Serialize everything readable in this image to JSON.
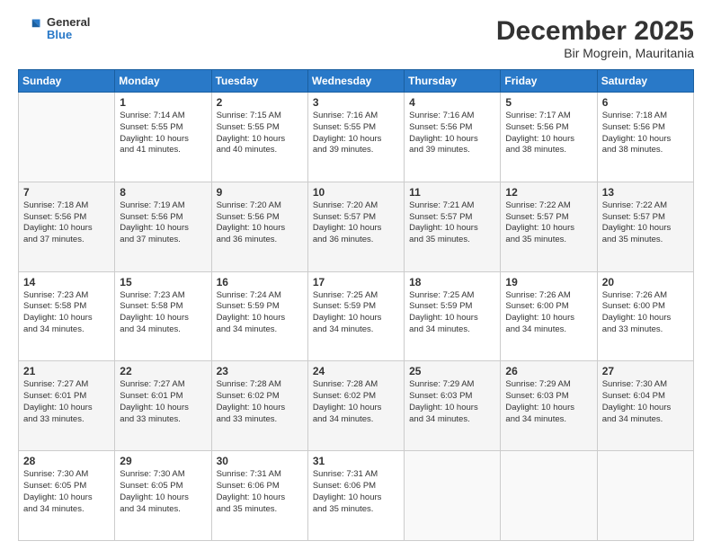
{
  "logo": {
    "general": "General",
    "blue": "Blue"
  },
  "header": {
    "month": "December 2025",
    "location": "Bir Mogrein, Mauritania"
  },
  "days_of_week": [
    "Sunday",
    "Monday",
    "Tuesday",
    "Wednesday",
    "Thursday",
    "Friday",
    "Saturday"
  ],
  "weeks": [
    [
      {
        "day": "",
        "info": ""
      },
      {
        "day": "1",
        "info": "Sunrise: 7:14 AM\nSunset: 5:55 PM\nDaylight: 10 hours\nand 41 minutes."
      },
      {
        "day": "2",
        "info": "Sunrise: 7:15 AM\nSunset: 5:55 PM\nDaylight: 10 hours\nand 40 minutes."
      },
      {
        "day": "3",
        "info": "Sunrise: 7:16 AM\nSunset: 5:55 PM\nDaylight: 10 hours\nand 39 minutes."
      },
      {
        "day": "4",
        "info": "Sunrise: 7:16 AM\nSunset: 5:56 PM\nDaylight: 10 hours\nand 39 minutes."
      },
      {
        "day": "5",
        "info": "Sunrise: 7:17 AM\nSunset: 5:56 PM\nDaylight: 10 hours\nand 38 minutes."
      },
      {
        "day": "6",
        "info": "Sunrise: 7:18 AM\nSunset: 5:56 PM\nDaylight: 10 hours\nand 38 minutes."
      }
    ],
    [
      {
        "day": "7",
        "info": "Sunrise: 7:18 AM\nSunset: 5:56 PM\nDaylight: 10 hours\nand 37 minutes."
      },
      {
        "day": "8",
        "info": "Sunrise: 7:19 AM\nSunset: 5:56 PM\nDaylight: 10 hours\nand 37 minutes."
      },
      {
        "day": "9",
        "info": "Sunrise: 7:20 AM\nSunset: 5:56 PM\nDaylight: 10 hours\nand 36 minutes."
      },
      {
        "day": "10",
        "info": "Sunrise: 7:20 AM\nSunset: 5:57 PM\nDaylight: 10 hours\nand 36 minutes."
      },
      {
        "day": "11",
        "info": "Sunrise: 7:21 AM\nSunset: 5:57 PM\nDaylight: 10 hours\nand 35 minutes."
      },
      {
        "day": "12",
        "info": "Sunrise: 7:22 AM\nSunset: 5:57 PM\nDaylight: 10 hours\nand 35 minutes."
      },
      {
        "day": "13",
        "info": "Sunrise: 7:22 AM\nSunset: 5:57 PM\nDaylight: 10 hours\nand 35 minutes."
      }
    ],
    [
      {
        "day": "14",
        "info": "Sunrise: 7:23 AM\nSunset: 5:58 PM\nDaylight: 10 hours\nand 34 minutes."
      },
      {
        "day": "15",
        "info": "Sunrise: 7:23 AM\nSunset: 5:58 PM\nDaylight: 10 hours\nand 34 minutes."
      },
      {
        "day": "16",
        "info": "Sunrise: 7:24 AM\nSunset: 5:59 PM\nDaylight: 10 hours\nand 34 minutes."
      },
      {
        "day": "17",
        "info": "Sunrise: 7:25 AM\nSunset: 5:59 PM\nDaylight: 10 hours\nand 34 minutes."
      },
      {
        "day": "18",
        "info": "Sunrise: 7:25 AM\nSunset: 5:59 PM\nDaylight: 10 hours\nand 34 minutes."
      },
      {
        "day": "19",
        "info": "Sunrise: 7:26 AM\nSunset: 6:00 PM\nDaylight: 10 hours\nand 34 minutes."
      },
      {
        "day": "20",
        "info": "Sunrise: 7:26 AM\nSunset: 6:00 PM\nDaylight: 10 hours\nand 33 minutes."
      }
    ],
    [
      {
        "day": "21",
        "info": "Sunrise: 7:27 AM\nSunset: 6:01 PM\nDaylight: 10 hours\nand 33 minutes."
      },
      {
        "day": "22",
        "info": "Sunrise: 7:27 AM\nSunset: 6:01 PM\nDaylight: 10 hours\nand 33 minutes."
      },
      {
        "day": "23",
        "info": "Sunrise: 7:28 AM\nSunset: 6:02 PM\nDaylight: 10 hours\nand 33 minutes."
      },
      {
        "day": "24",
        "info": "Sunrise: 7:28 AM\nSunset: 6:02 PM\nDaylight: 10 hours\nand 34 minutes."
      },
      {
        "day": "25",
        "info": "Sunrise: 7:29 AM\nSunset: 6:03 PM\nDaylight: 10 hours\nand 34 minutes."
      },
      {
        "day": "26",
        "info": "Sunrise: 7:29 AM\nSunset: 6:03 PM\nDaylight: 10 hours\nand 34 minutes."
      },
      {
        "day": "27",
        "info": "Sunrise: 7:30 AM\nSunset: 6:04 PM\nDaylight: 10 hours\nand 34 minutes."
      }
    ],
    [
      {
        "day": "28",
        "info": "Sunrise: 7:30 AM\nSunset: 6:05 PM\nDaylight: 10 hours\nand 34 minutes."
      },
      {
        "day": "29",
        "info": "Sunrise: 7:30 AM\nSunset: 6:05 PM\nDaylight: 10 hours\nand 34 minutes."
      },
      {
        "day": "30",
        "info": "Sunrise: 7:31 AM\nSunset: 6:06 PM\nDaylight: 10 hours\nand 35 minutes."
      },
      {
        "day": "31",
        "info": "Sunrise: 7:31 AM\nSunset: 6:06 PM\nDaylight: 10 hours\nand 35 minutes."
      },
      {
        "day": "",
        "info": ""
      },
      {
        "day": "",
        "info": ""
      },
      {
        "day": "",
        "info": ""
      }
    ]
  ]
}
